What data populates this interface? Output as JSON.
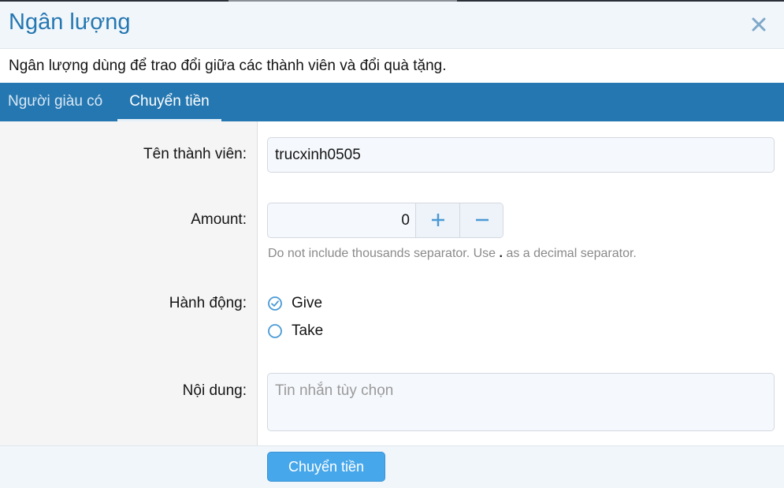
{
  "dialog": {
    "title": "Ngân lượng",
    "description": "Ngân lượng dùng để trao đổi giữa các thành viên và đổi quà tặng."
  },
  "tabs": [
    {
      "label": "Người giàu có",
      "active": false
    },
    {
      "label": "Chuyển tiền",
      "active": true
    }
  ],
  "form": {
    "username_label": "Tên thành viên:",
    "username_value": "trucxinh0505",
    "amount_label": "Amount:",
    "amount_value": "0",
    "amount_hint_before": "Do not include thousands separator. Use",
    "amount_hint_sep": ".",
    "amount_hint_after": "as a decimal separator.",
    "action_label": "Hành động:",
    "action_options": [
      {
        "label": "Give",
        "selected": true
      },
      {
        "label": "Take",
        "selected": false
      }
    ],
    "message_label": "Nội dung:",
    "message_placeholder": "Tin nhắn tùy chọn",
    "message_value": ""
  },
  "footer": {
    "submit_label": "Chuyển tiền"
  },
  "colors": {
    "accent": "#2577b1",
    "button": "#47a7eb",
    "icon": "#4a9ad6"
  },
  "icons": {
    "close": "close-icon",
    "plus": "plus-icon",
    "minus": "minus-icon",
    "radio_checked": "radio-checked-icon",
    "radio_unchecked": "radio-unchecked-icon"
  }
}
